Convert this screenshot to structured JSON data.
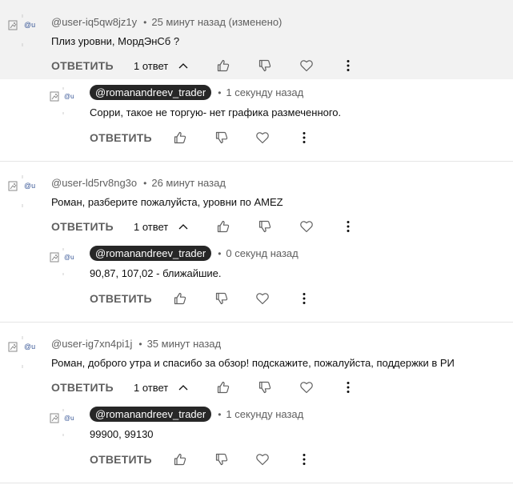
{
  "threads": [
    {
      "author": "@user-iq5qw8jz1y",
      "avatar_label": "@u",
      "time": "25 минут назад (изменено)",
      "text": "Плиз уровни, МордЭнСб ?",
      "reply_label": "ОТВЕТИТЬ",
      "replies_count": "1 ответ",
      "reply": {
        "author": "@romanandreev_trader",
        "time": "1 секунду назад",
        "text": "Сорри, такое не торгую- нет графика размеченного.",
        "reply_label": "ОТВЕТИТЬ"
      }
    },
    {
      "author": "@user-ld5rv8ng3o",
      "avatar_label": "@u",
      "time": "26 минут назад",
      "text": "Роман, разберите пожалуйста, уровни по AMEZ",
      "reply_label": "ОТВЕТИТЬ",
      "replies_count": "1 ответ",
      "reply": {
        "author": "@romanandreev_trader",
        "time": "0 секунд назад",
        "text": "90,87, 107,02 - ближайшие.",
        "reply_label": "ОТВЕТИТЬ"
      }
    },
    {
      "author": "@user-ig7xn4pi1j",
      "avatar_label": "@u",
      "time": "35 минут назад",
      "text": "Роман, доброго утра и спасибо за обзор! подскажите, пожалуйста, поддержки в РИ",
      "reply_label": "ОТВЕТИТЬ",
      "replies_count": "1 ответ",
      "reply": {
        "author": "@romanandreev_trader",
        "time": "1 секунду назад",
        "text": "99900, 99130",
        "reply_label": "ОТВЕТИТЬ"
      }
    }
  ],
  "icons": {
    "like": "thumbs-up-icon",
    "dislike": "thumbs-down-icon",
    "heart": "heart-icon",
    "more": "more-vertical-icon",
    "chevron": "chevron-up-icon",
    "avatar": "broken-image-icon"
  }
}
